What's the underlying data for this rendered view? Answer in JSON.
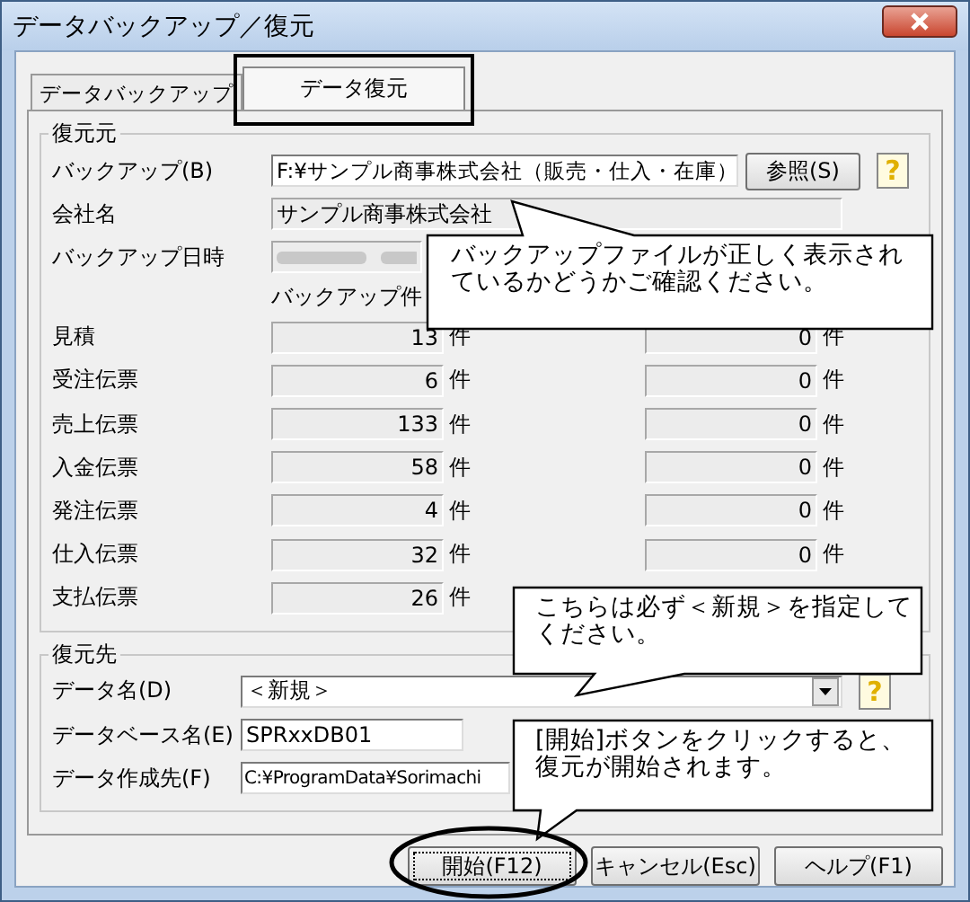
{
  "window": {
    "title": "データバックアップ／復元"
  },
  "tabs": [
    {
      "label": "データバックアップ",
      "selected": false
    },
    {
      "label": "データ復元",
      "selected": true
    }
  ],
  "source": {
    "title": "復元元",
    "backup": {
      "label": "バックアップ(B)",
      "value": "F:¥サンプル商事株式会社（販売・仕入・在庫）",
      "browse_button": "参照(S)",
      "help_button": "?"
    },
    "company": {
      "label": "会社名",
      "value": "サンプル商事株式会社"
    },
    "datetime": {
      "label": "バックアップ日時"
    },
    "count_header": "バックアップ件",
    "counts": [
      {
        "label": "見積",
        "backup": "13",
        "backup_unit": "件",
        "current": "0",
        "current_unit": "件"
      },
      {
        "label": "受注伝票",
        "backup": "6",
        "backup_unit": "件",
        "current": "0",
        "current_unit": "件"
      },
      {
        "label": "売上伝票",
        "backup": "133",
        "backup_unit": "件",
        "current": "0",
        "current_unit": "件"
      },
      {
        "label": "入金伝票",
        "backup": "58",
        "backup_unit": "件",
        "current": "0",
        "current_unit": "件"
      },
      {
        "label": "発注伝票",
        "backup": "4",
        "backup_unit": "件",
        "current": "0",
        "current_unit": "件"
      },
      {
        "label": "仕入伝票",
        "backup": "32",
        "backup_unit": "件",
        "current": "0",
        "current_unit": "件"
      },
      {
        "label": "支払伝票",
        "backup": "26",
        "backup_unit": "件"
      }
    ]
  },
  "destination": {
    "title": "復元先",
    "data_name": {
      "label": "データ名(D)",
      "value": "＜新規＞",
      "help_button": "?"
    },
    "db_name": {
      "label": "データベース名(E)",
      "value": "SPRxxDB01"
    },
    "path": {
      "label": "データ作成先(F)",
      "value": "C:¥ProgramData¥Sorimachi"
    }
  },
  "buttons": [
    {
      "label": "開始(F12)",
      "focused": true
    },
    {
      "label": "キャンセル(Esc)",
      "focused": false
    },
    {
      "label": "ヘルプ(F1)",
      "focused": false
    }
  ],
  "callouts": [
    {
      "text": "バックアップファイルが正しく表示されているかどうかご確認ください。"
    },
    {
      "text": "こちらは必ず＜新規＞を指定してください。"
    },
    {
      "text": "[開始]ボタンをクリックすると、復元が開始されます。"
    }
  ]
}
